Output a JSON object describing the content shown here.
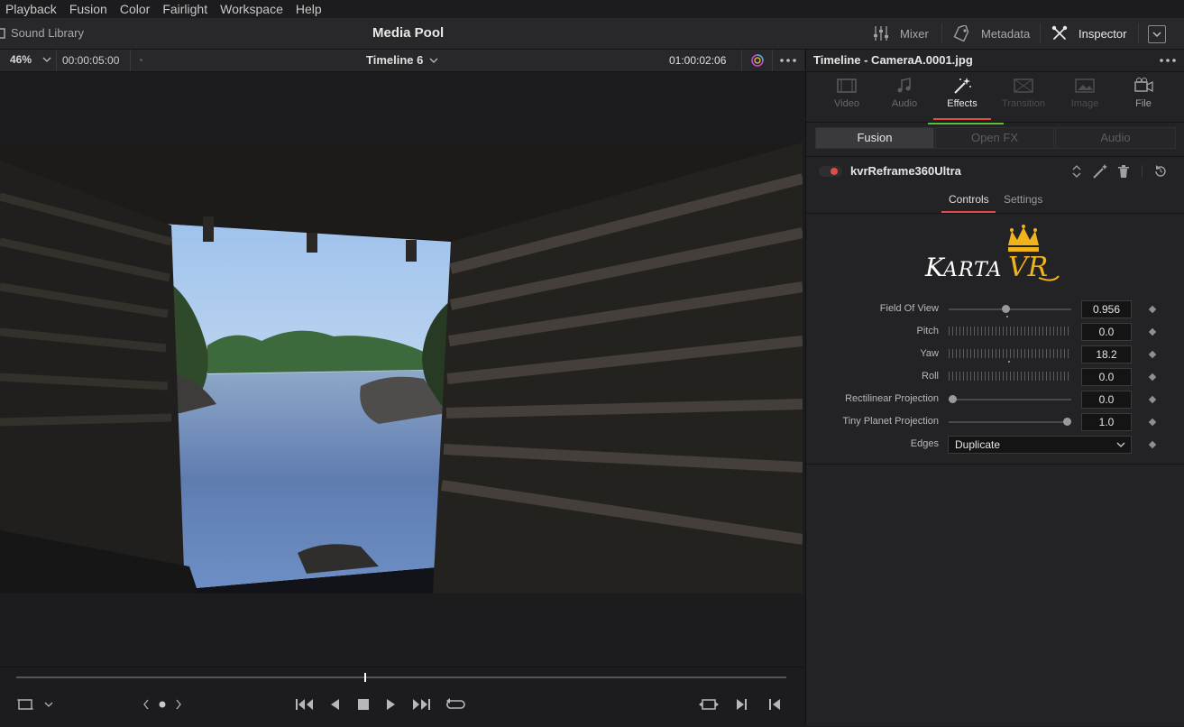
{
  "menu": [
    "Playback",
    "Fusion",
    "Color",
    "Fairlight",
    "Workspace",
    "Help"
  ],
  "toolbar": {
    "sound_library": "Sound Library",
    "media_pool": "Media Pool",
    "mixer": "Mixer",
    "metadata": "Metadata",
    "inspector": "Inspector"
  },
  "viewer": {
    "zoom": "46%",
    "timecode_duration": "00:00:05:00",
    "timeline_name": "Timeline 6",
    "timecode_current": "01:00:02:06"
  },
  "inspector": {
    "title": "Timeline - CameraA.0001.jpg",
    "tabs": [
      {
        "label": "Video",
        "icon": "video-icon",
        "active": false
      },
      {
        "label": "Audio",
        "icon": "music-note-icon",
        "active": false
      },
      {
        "label": "Effects",
        "icon": "magic-wand-icon",
        "active": true
      },
      {
        "label": "Transition",
        "icon": "transition-icon",
        "active": false
      },
      {
        "label": "Image",
        "icon": "image-icon",
        "active": false
      },
      {
        "label": "File",
        "icon": "film-camera-icon",
        "active": false
      }
    ],
    "segments": [
      "Fusion",
      "Open FX",
      "Audio"
    ],
    "effect_name": "kvrReframe360Ultra",
    "subtabs": [
      "Controls",
      "Settings"
    ],
    "logo_text": "KARTA VR",
    "params": [
      {
        "label": "Field Of View",
        "value": "0.956",
        "control": "slider",
        "level": 0.46
      },
      {
        "label": "Pitch",
        "value": "0.0",
        "control": "ticks"
      },
      {
        "label": "Yaw",
        "value": "18.2",
        "control": "ticks"
      },
      {
        "label": "Roll",
        "value": "0.0",
        "control": "ticks"
      },
      {
        "label": "Rectilinear Projection",
        "value": "0.0",
        "control": "slider",
        "level": 0.0
      },
      {
        "label": "Tiny Planet Projection",
        "value": "1.0",
        "control": "slider",
        "level": 1.0
      }
    ],
    "edges": {
      "label": "Edges",
      "value": "Duplicate"
    }
  },
  "colors": {
    "accent_red": "#e04b4b",
    "accent_green": "#5bbf3b",
    "logo_gold": "#f1b31c"
  }
}
